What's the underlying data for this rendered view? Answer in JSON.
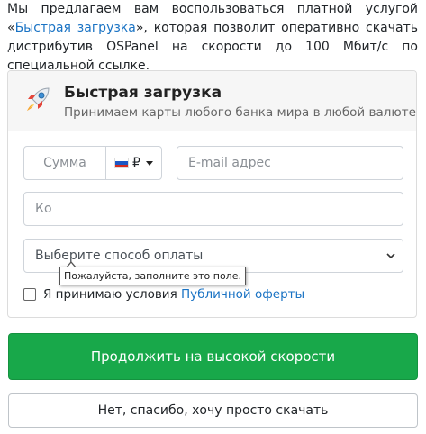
{
  "intro": {
    "text_before": "Мы предлагаем вам воспользоваться платной услугой «",
    "link": "Быстрая загрузка",
    "text_after": "», которая позволит оперативно скачать дистрибутив OSPanel на скорости до 100 Мбит/с по специальной ссылке."
  },
  "card": {
    "title": "Быстрая загрузка",
    "subtitle": "Принимаем карты любого банка мира в любой валюте",
    "icon": "rocket-icon"
  },
  "form": {
    "amount_placeholder": "Сумма",
    "currency": "₽",
    "email_placeholder": "E-mail адрес",
    "code_placeholder_visible": "Ко",
    "payment_select": "Выберите способ оплаты",
    "tooltip": "Пожалуйста, заполните это поле.",
    "agree_text": "Я принимаю условия ",
    "agree_link": "Публичной оферты"
  },
  "buttons": {
    "primary": "Продолжить на высокой скорости",
    "secondary": "Нет, спасибо, хочу просто скачать"
  },
  "colors": {
    "accent_green": "#18a84a",
    "link_blue": "#1a73c4"
  }
}
